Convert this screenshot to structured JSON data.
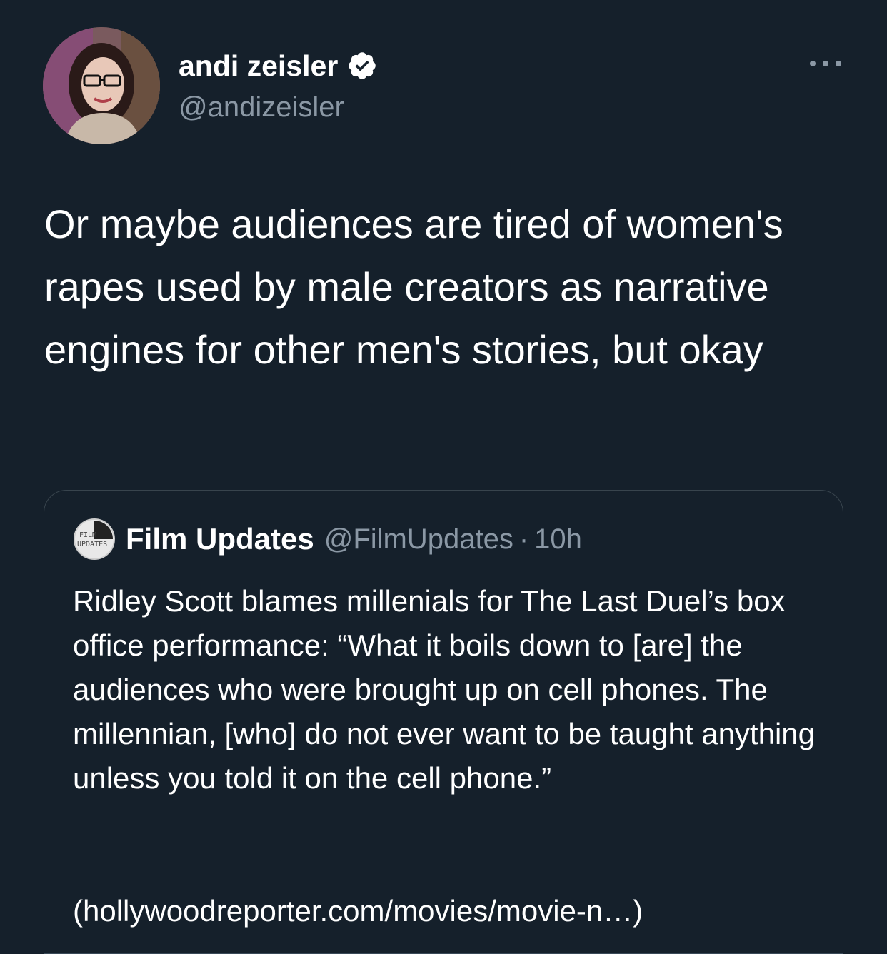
{
  "author": {
    "display_name": "andi zeisler",
    "handle": "@andizeisler",
    "verified": true,
    "avatar_icon": "profile-photo"
  },
  "tweet": {
    "text": "Or maybe audiences are tired of women's rapes used by male creators as narrative engines for other men's stories, but okay"
  },
  "quoted": {
    "display_name": "Film Updates",
    "handle": "@FilmUpdates",
    "separator": "·",
    "time": "10h",
    "text": "Ridley Scott blames millenials for The Last Duel’s box office performance: “What it boils down to [are] the audiences who were brought up on cell phones. The millennian, [who] do not ever want to be taught anything unless you told it on the cell phone.”",
    "link": "(hollywoodreporter.com/movies/movie-n…)"
  },
  "icons": {
    "more": "more-horizontal-icon",
    "verified": "verified-badge-icon"
  },
  "colors": {
    "background": "#15202b",
    "secondary_text": "#8b98a5",
    "border": "#38444d",
    "verified_badge": "#ffffff"
  }
}
